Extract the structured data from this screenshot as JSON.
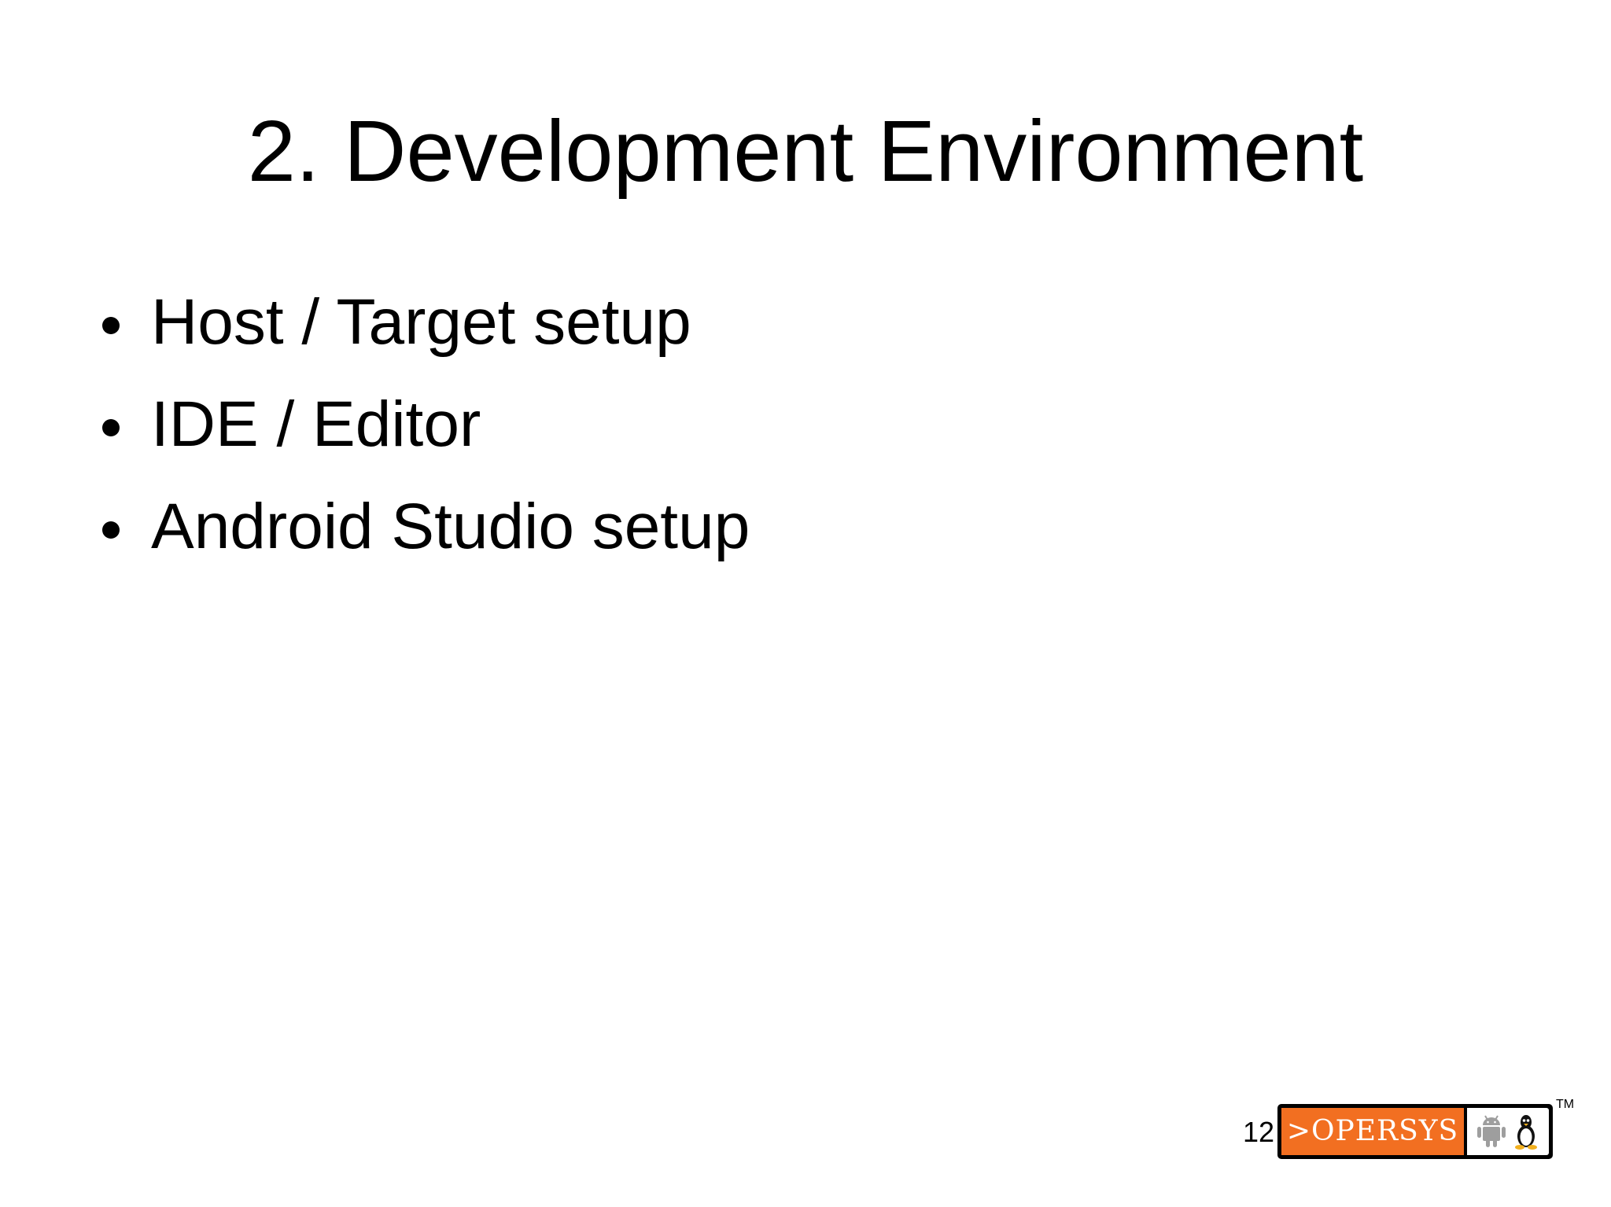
{
  "slide": {
    "title": "2. Development Environment",
    "bullets": [
      "Host / Target setup",
      "IDE / Editor",
      "Android Studio setup"
    ],
    "page_number": "12"
  },
  "logo": {
    "text": ">OPERSYS",
    "trademark": "TM",
    "brand_color": "#f26f21",
    "icons": [
      "android-icon",
      "tux-penguin-icon"
    ]
  }
}
